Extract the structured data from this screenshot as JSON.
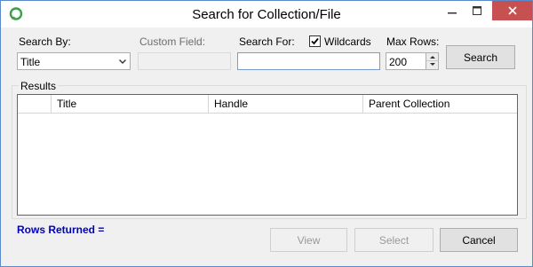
{
  "window": {
    "title": "Search for Collection/File",
    "colors": {
      "close_button": "#c75050",
      "rows_returned_text": "#0000c0",
      "app_icon": "#3aa04a"
    }
  },
  "search": {
    "search_by_label": "Search By:",
    "search_by_value": "Title",
    "custom_field_label": "Custom Field:",
    "search_for_label": "Search For:",
    "search_for_value": "",
    "wildcards_label": "Wildcards",
    "wildcards_checked": true,
    "max_rows_label": "Max Rows:",
    "max_rows_value": "200",
    "search_button": "Search"
  },
  "results": {
    "group_label": "Results",
    "columns": [
      "",
      "Title",
      "Handle",
      "Parent Collection"
    ],
    "rows": []
  },
  "footer": {
    "rows_returned": "Rows Returned =",
    "view_button": "View",
    "select_button": "Select",
    "cancel_button": "Cancel"
  }
}
